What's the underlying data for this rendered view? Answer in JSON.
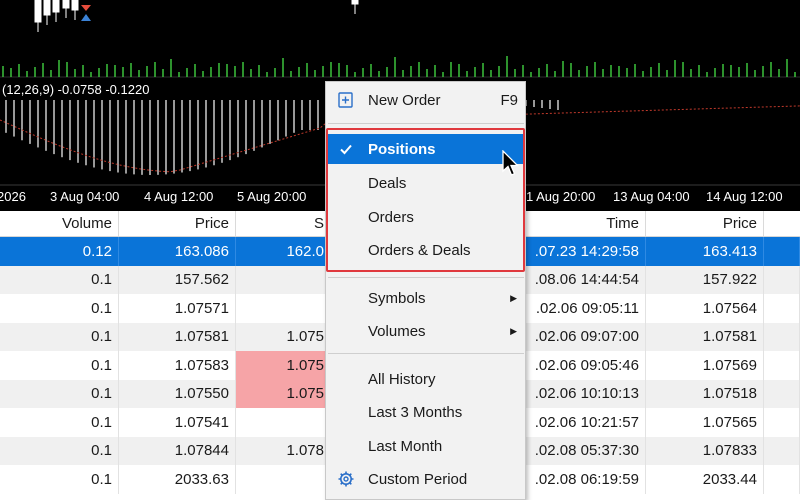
{
  "chart": {
    "indicator_label": "(12,26,9) -0.0758 -0.1220",
    "time_labels": [
      "2026",
      "3 Aug 04:00",
      "4 Aug 12:00",
      "5 Aug 20:00",
      "1 Aug 20:00",
      "13 Aug 04:00",
      "14 Aug 12:00"
    ],
    "colors": {
      "background": "#000000",
      "volume_bars": "#3cc23c",
      "histogram": "#ffffff",
      "signal_line": "#c0392b"
    }
  },
  "table": {
    "headers": [
      "Volume",
      "Price",
      "S",
      "Time",
      "Price"
    ],
    "rows": [
      {
        "volume": "0.12",
        "price": "163.086",
        "s": "162.0",
        "time": ".07.23 14:29:58",
        "price2": "163.413",
        "selected": true
      },
      {
        "volume": "0.1",
        "price": "157.562",
        "s": "",
        "time": ".08.06 14:44:54",
        "price2": "157.922"
      },
      {
        "volume": "0.1",
        "price": "1.07571",
        "s": "",
        "time": ".02.06 09:05:11",
        "price2": "1.07564"
      },
      {
        "volume": "0.1",
        "price": "1.07581",
        "s": "1.075",
        "time": ".02.06 09:07:00",
        "price2": "1.07581"
      },
      {
        "volume": "0.1",
        "price": "1.07583",
        "s": "1.075",
        "time": ".02.06 09:05:46",
        "price2": "1.07569",
        "pink": true
      },
      {
        "volume": "0.1",
        "price": "1.07550",
        "s": "1.075",
        "time": ".02.06 10:10:13",
        "price2": "1.07518",
        "pink": true
      },
      {
        "volume": "0.1",
        "price": "1.07541",
        "s": "",
        "time": ".02.06 10:21:57",
        "price2": "1.07565"
      },
      {
        "volume": "0.1",
        "price": "1.07844",
        "s": "1.078",
        "time": ".02.08 05:37:30",
        "price2": "1.07833"
      },
      {
        "volume": "0.1",
        "price": "2033.63",
        "s": "",
        "time": ".02.08 06:19:59",
        "price2": "2033.44"
      }
    ]
  },
  "menu": {
    "new_order": {
      "label": "New Order",
      "shortcut": "F9",
      "icon": "new-order-icon"
    },
    "positions": {
      "label": "Positions",
      "checked": true
    },
    "deals": {
      "label": "Deals"
    },
    "orders": {
      "label": "Orders"
    },
    "orders_deals": {
      "label": "Orders & Deals"
    },
    "symbols": {
      "label": "Symbols"
    },
    "volumes": {
      "label": "Volumes"
    },
    "all_history": {
      "label": "All History"
    },
    "last_3_months": {
      "label": "Last 3 Months"
    },
    "last_month": {
      "label": "Last Month"
    },
    "custom_period": {
      "label": "Custom Period",
      "icon": "gear-icon"
    },
    "colors": {
      "highlight": "#0a74d8",
      "outline": "#e0393e"
    }
  }
}
